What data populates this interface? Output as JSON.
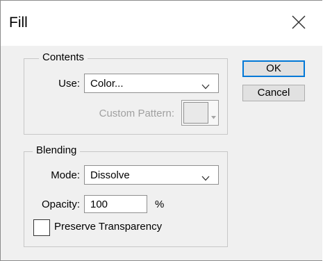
{
  "window": {
    "title": "Fill",
    "close_icon": "close-icon"
  },
  "contents": {
    "legend": "Contents",
    "use_label": "Use:",
    "use_value": "Color...",
    "custom_pattern_label": "Custom Pattern:"
  },
  "blending": {
    "legend": "Blending",
    "mode_label": "Mode:",
    "mode_value": "Dissolve",
    "opacity_label": "Opacity:",
    "opacity_value": "100",
    "opacity_unit": "%",
    "preserve_label": "Preserve Transparency",
    "preserve_checked": false
  },
  "buttons": {
    "ok": "OK",
    "cancel": "Cancel"
  },
  "colors": {
    "accent": "#0078d7",
    "dialog_bg": "#f0f0f0",
    "title_bg": "#ffffff"
  }
}
